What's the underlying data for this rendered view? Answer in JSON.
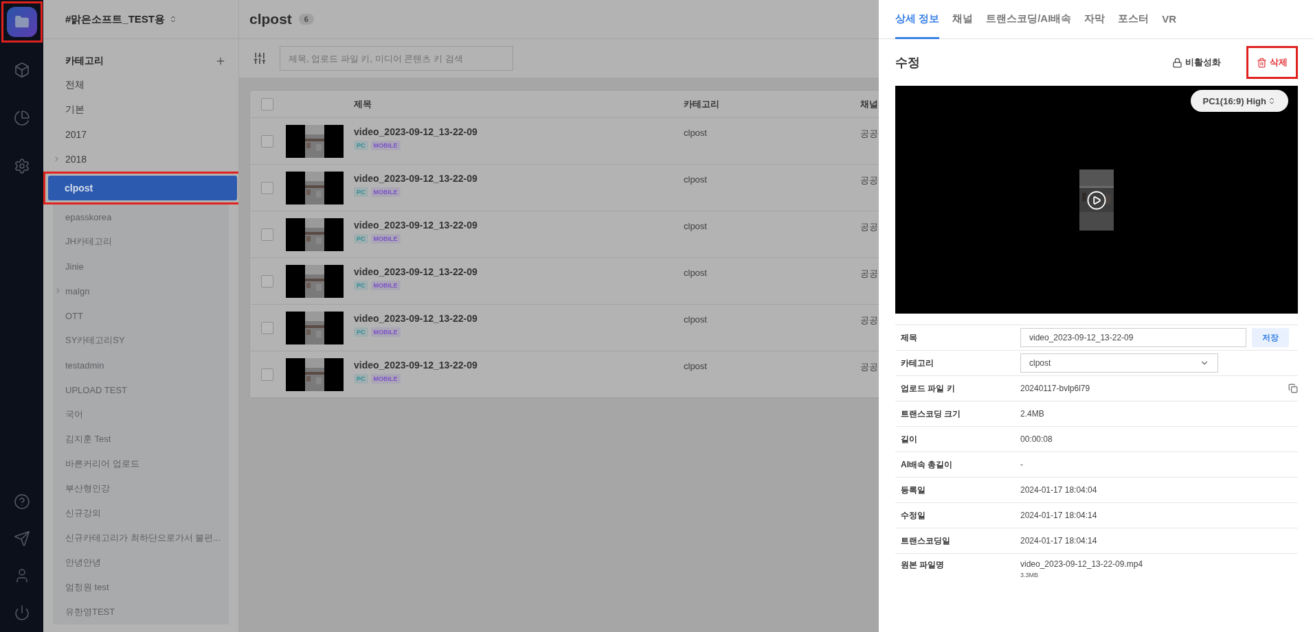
{
  "nav": {
    "top": [
      {
        "kind": "folder",
        "selected": true,
        "highlighted": true
      },
      {
        "kind": "box",
        "selected": false,
        "highlighted": false
      },
      {
        "kind": "chart",
        "selected": false,
        "highlighted": false
      },
      {
        "kind": "settings",
        "selected": false,
        "highlighted": false
      }
    ],
    "bottom": [
      {
        "kind": "help"
      },
      {
        "kind": "send"
      },
      {
        "kind": "user"
      },
      {
        "kind": "power"
      }
    ]
  },
  "workspace": {
    "title": "#맑은소프트_TEST용"
  },
  "categories": {
    "heading": "카테고리",
    "items": [
      {
        "label": "전체",
        "selected": false,
        "faded": false,
        "expandable": false,
        "highlighted": false
      },
      {
        "label": "기본",
        "selected": false,
        "faded": false,
        "expandable": false,
        "highlighted": false
      },
      {
        "label": "2017",
        "selected": false,
        "faded": false,
        "expandable": false,
        "highlighted": false
      },
      {
        "label": "2018",
        "selected": false,
        "faded": false,
        "expandable": true,
        "highlighted": false
      },
      {
        "label": "clpost",
        "selected": true,
        "faded": false,
        "expandable": false,
        "highlighted": true
      },
      {
        "label": "epasskorea",
        "selected": false,
        "faded": true,
        "expandable": false,
        "highlighted": false
      },
      {
        "label": "JH카테고리",
        "selected": false,
        "faded": true,
        "expandable": false,
        "highlighted": false
      },
      {
        "label": "Jinie",
        "selected": false,
        "faded": true,
        "expandable": false,
        "highlighted": false
      },
      {
        "label": "malgn",
        "selected": false,
        "faded": true,
        "expandable": true,
        "highlighted": false
      },
      {
        "label": "OTT",
        "selected": false,
        "faded": true,
        "expandable": false,
        "highlighted": false
      },
      {
        "label": "SY카테고리SY",
        "selected": false,
        "faded": true,
        "expandable": false,
        "highlighted": false
      },
      {
        "label": "testadmin",
        "selected": false,
        "faded": true,
        "expandable": false,
        "highlighted": false
      },
      {
        "label": "UPLOAD TEST",
        "selected": false,
        "faded": true,
        "expandable": false,
        "highlighted": false
      },
      {
        "label": "국어",
        "selected": false,
        "faded": true,
        "expandable": false,
        "highlighted": false
      },
      {
        "label": "김지훈 Test",
        "selected": false,
        "faded": true,
        "expandable": false,
        "highlighted": false
      },
      {
        "label": "바른커리어 업로드",
        "selected": false,
        "faded": true,
        "expandable": false,
        "highlighted": false
      },
      {
        "label": "부산형인강",
        "selected": false,
        "faded": true,
        "expandable": false,
        "highlighted": false
      },
      {
        "label": "신규강의",
        "selected": false,
        "faded": true,
        "expandable": false,
        "highlighted": false
      },
      {
        "label": "신규카테고리가 최하단으로가서 불편...",
        "selected": false,
        "faded": true,
        "expandable": false,
        "highlighted": false
      },
      {
        "label": "안녕안녕",
        "selected": false,
        "faded": true,
        "expandable": false,
        "highlighted": false
      },
      {
        "label": "엄정원 test",
        "selected": false,
        "faded": true,
        "expandable": false,
        "highlighted": false
      },
      {
        "label": "유한영TEST",
        "selected": false,
        "faded": true,
        "expandable": false,
        "highlighted": false
      }
    ]
  },
  "list": {
    "title": "clpost",
    "count": "6",
    "search": {
      "placeholder": "제목, 업로드 파일 키, 미디어 콘텐츠 키 검색"
    },
    "all_checked": false,
    "columns": [
      "제목",
      "카테고리",
      "채널"
    ],
    "rows": [
      {
        "checked": false,
        "title": "video_2023-09-12_13-22-09",
        "tags": [
          {
            "label": "PC",
            "color": "#2f8f98"
          },
          {
            "label": "MOBILE",
            "color": "#7b52c7"
          }
        ],
        "category": "clpost",
        "channel": "공공"
      },
      {
        "checked": false,
        "title": "video_2023-09-12_13-22-09",
        "tags": [
          {
            "label": "PC",
            "color": "#2f8f98"
          },
          {
            "label": "MOBILE",
            "color": "#7b52c7"
          }
        ],
        "category": "clpost",
        "channel": "공공"
      },
      {
        "checked": false,
        "title": "video_2023-09-12_13-22-09",
        "tags": [
          {
            "label": "PC",
            "color": "#2f8f98"
          },
          {
            "label": "MOBILE",
            "color": "#7b52c7"
          }
        ],
        "category": "clpost",
        "channel": "공공"
      },
      {
        "checked": false,
        "title": "video_2023-09-12_13-22-09",
        "tags": [
          {
            "label": "PC",
            "color": "#2f8f98"
          },
          {
            "label": "MOBILE",
            "color": "#7b52c7"
          }
        ],
        "category": "clpost",
        "channel": "공공"
      },
      {
        "checked": false,
        "title": "video_2023-09-12_13-22-09",
        "tags": [
          {
            "label": "PC",
            "color": "#2f8f98"
          },
          {
            "label": "MOBILE",
            "color": "#7b52c7"
          }
        ],
        "category": "clpost",
        "channel": "공공"
      },
      {
        "checked": false,
        "title": "video_2023-09-12_13-22-09",
        "tags": [
          {
            "label": "PC",
            "color": "#2f8f98"
          },
          {
            "label": "MOBILE",
            "color": "#7b52c7"
          }
        ],
        "category": "clpost",
        "channel": "공공"
      }
    ]
  },
  "detail": {
    "tabs": [
      {
        "label": "상세 정보",
        "selected": true
      },
      {
        "label": "채널",
        "selected": false
      },
      {
        "label": "트랜스코딩/AI배속",
        "selected": false
      },
      {
        "label": "자막",
        "selected": false
      },
      {
        "label": "포스터",
        "selected": false
      },
      {
        "label": "VR",
        "selected": false
      }
    ],
    "heading": "수정",
    "actions": [
      {
        "kind": "deactivate",
        "label": "비활성화",
        "highlighted": false
      },
      {
        "kind": "delete",
        "label": "삭제",
        "highlighted": true
      }
    ],
    "player": {
      "quality": "PC1(16:9) High"
    },
    "fields": [
      {
        "kind": "input",
        "label": "제목",
        "value": "video_2023-09-12_13-22-09",
        "button": "저장"
      },
      {
        "kind": "select",
        "label": "카테고리",
        "value": "clpost"
      },
      {
        "kind": "copy",
        "label": "업로드 파일 키",
        "value": "20240117-bvlp6l79"
      },
      {
        "kind": "text",
        "label": "트랜스코딩 크기",
        "value": "2.4MB"
      },
      {
        "kind": "text",
        "label": "길이",
        "value": "00:00:08"
      },
      {
        "kind": "text",
        "label": "AI배속 총길이",
        "value": "-"
      },
      {
        "kind": "text",
        "label": "등록일",
        "value": "2024-01-17 18:04:04"
      },
      {
        "kind": "text",
        "label": "수정일",
        "value": "2024-01-17 18:04:14"
      },
      {
        "kind": "text",
        "label": "트랜스코딩일",
        "value": "2024-01-17 18:04:14"
      },
      {
        "kind": "file",
        "label": "원본 파일명",
        "value": "video_2023-09-12_13-22-09.mp4",
        "sub": "3.3MB"
      }
    ]
  }
}
